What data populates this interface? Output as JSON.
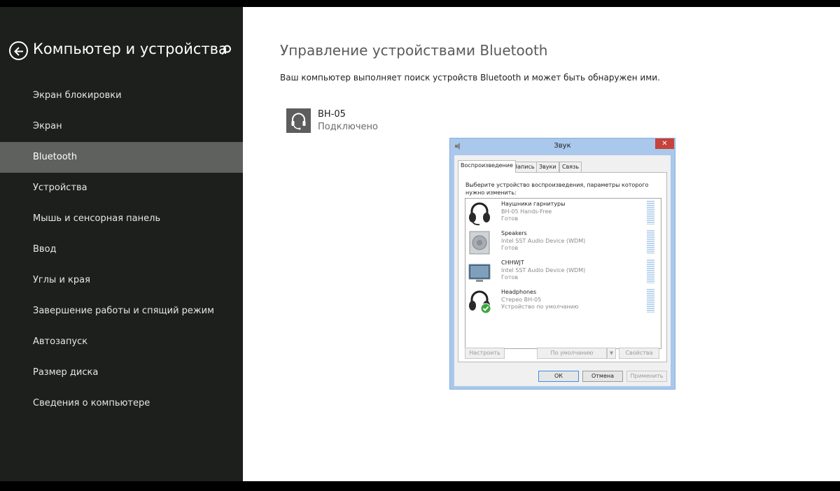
{
  "sidebar": {
    "title": "Компьютер и устройства",
    "items": [
      {
        "label": "Экран блокировки"
      },
      {
        "label": "Экран"
      },
      {
        "label": "Bluetooth"
      },
      {
        "label": "Устройства"
      },
      {
        "label": "Мышь и сенсорная панель"
      },
      {
        "label": "Ввод"
      },
      {
        "label": "Углы и края"
      },
      {
        "label": "Завершение работы и спящий режим"
      },
      {
        "label": "Автозапуск"
      },
      {
        "label": "Размер диска"
      },
      {
        "label": "Сведения о компьютере"
      }
    ],
    "selected": "Bluetooth"
  },
  "main": {
    "title": "Управление устройствами Bluetooth",
    "description": "Ваш компьютер выполняет поиск устройств Bluetooth и может быть обнаружен ими.",
    "device": {
      "name": "BH-05",
      "status": "Подключено",
      "icon": "headset-icon"
    }
  },
  "dialog": {
    "title": "Звук",
    "close_label": "✕",
    "tabs": [
      {
        "label": "Воспроизведение"
      },
      {
        "label": "Запись"
      },
      {
        "label": "Звуки"
      },
      {
        "label": "Связь"
      }
    ],
    "instruction": "Выберите устройство воспроизведения, параметры которого нужно изменить:",
    "devices": [
      {
        "name": "Наушники гарнитуры",
        "detail": "BH-05 Hands-Free",
        "status": "Готов",
        "icon": "headset-icon"
      },
      {
        "name": "Speakers",
        "detail": "Intel SST Audio Device (WDM)",
        "status": "Готов",
        "icon": "speaker-icon"
      },
      {
        "name": "CHHWJT",
        "detail": "Intel SST Audio Device (WDM)",
        "status": "Готов",
        "icon": "monitor-icon"
      },
      {
        "name": "Headphones",
        "detail": "Стерео BH-05",
        "status": "Устройство по умолчанию",
        "icon": "headphones-icon"
      }
    ],
    "buttons": {
      "configure": "Настроить",
      "set_default": "По умолчанию",
      "properties": "Свойства",
      "ok": "ОК",
      "cancel": "Отмена",
      "apply": "Применить"
    }
  }
}
